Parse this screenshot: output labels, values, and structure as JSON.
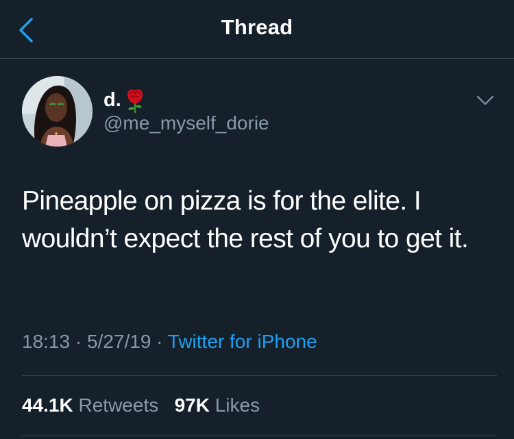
{
  "header": {
    "title": "Thread"
  },
  "tweet": {
    "display_name": "d.",
    "handle": "@me_myself_dorie",
    "text": "Pineapple on pizza is for the elite. I wouldn’t expect the rest of you to get it.",
    "time": "18:13",
    "date": "5/27/19",
    "separator": "·",
    "source": "Twitter for iPhone",
    "retweets": "44.1K",
    "retweets_label": "Retweets",
    "likes": "97K",
    "likes_label": "Likes"
  },
  "icons": {
    "back": "chevron-left-icon",
    "name_emoji": "rose-icon",
    "more": "chevron-down-icon",
    "avatar": "avatar"
  },
  "colors": {
    "background": "#15202b",
    "accent": "#1da1f2",
    "secondary_text": "#8899a6",
    "divider": "#38444d",
    "primary_text": "#ffffff"
  }
}
